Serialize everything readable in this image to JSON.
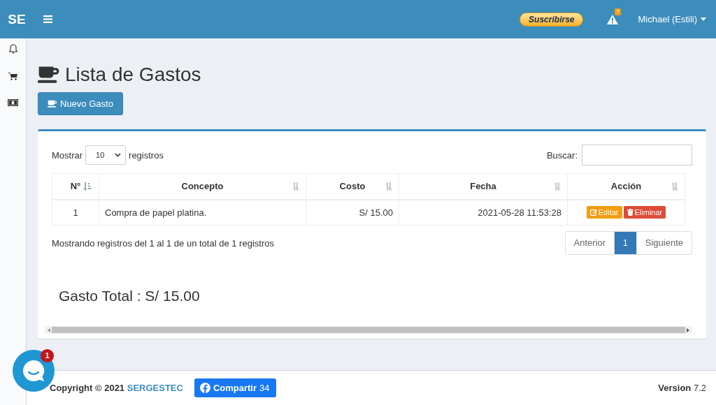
{
  "header": {
    "logo": "SE",
    "subscribe_button": "Suscribirse",
    "alert_count": "7",
    "user": "Michael (Estili)"
  },
  "page": {
    "title": "Lista de Gastos",
    "new_button": "Nuevo Gasto"
  },
  "table": {
    "length_label_before": "Mostrar",
    "length_value": "10",
    "length_label_after": "registros",
    "search_label": "Buscar:",
    "columns": [
      {
        "label": "N°",
        "sorted": true
      },
      {
        "label": "Concepto",
        "sorted": false
      },
      {
        "label": "Costo",
        "sorted": false
      },
      {
        "label": "Fecha",
        "sorted": false
      },
      {
        "label": "Acción",
        "sorted": false
      }
    ],
    "rows": [
      {
        "cells": [
          "1",
          "Compra de papel platina.",
          "S/ 15.00",
          "2021-05-28 11:53:28"
        ],
        "actions": [
          {
            "kind": "edit",
            "label": "Editar"
          },
          {
            "kind": "delete",
            "label": "Eliminar"
          }
        ]
      }
    ],
    "info": "Mostrando registros del 1 al 1 de un total de 1 registros",
    "pagination": [
      {
        "label": "Anterior",
        "selected": false
      },
      {
        "label": "1",
        "selected": true
      },
      {
        "label": "Siguiente",
        "selected": false
      }
    ]
  },
  "total": "Gasto Total : S/ 15.00",
  "footer": {
    "copyright": "Copyright © 2021",
    "company": "SERGESTEC",
    "share_button": "Compartir",
    "share_count": "34",
    "version_label": "Version",
    "version": "7.2"
  },
  "chat": {
    "badge": "1"
  }
}
